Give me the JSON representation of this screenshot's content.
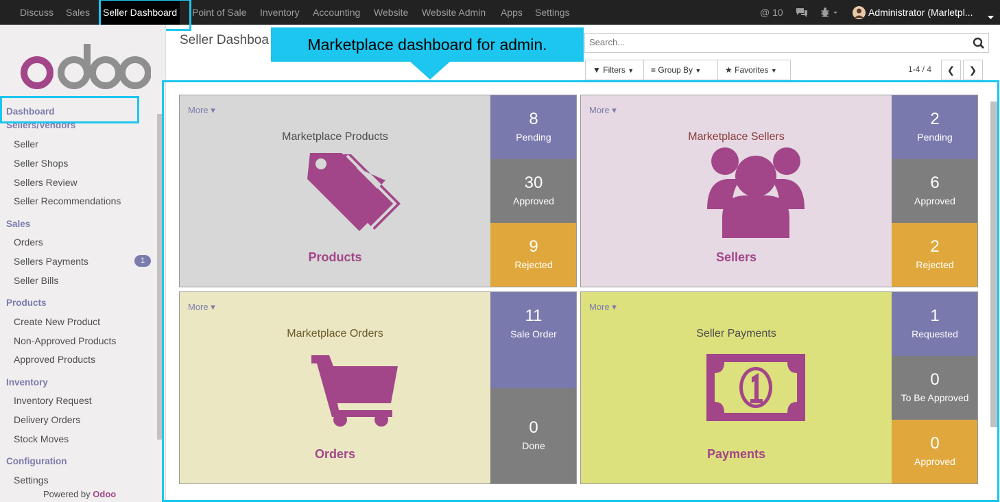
{
  "topnav": {
    "items": [
      "Discuss",
      "Sales",
      "Seller Dashboard",
      "Point of Sale",
      "Inventory",
      "Accounting",
      "Website",
      "Website Admin",
      "Apps",
      "Settings"
    ],
    "mentions": "@ 10",
    "user": "Administrator (Marletpl..."
  },
  "sidebar": {
    "sections": [
      {
        "title": "Dashboard",
        "items": []
      },
      {
        "title": "Sellers/Vendors",
        "items": [
          "Seller",
          "Seller Shops",
          "Sellers Review",
          "Seller Recommendations"
        ]
      },
      {
        "title": "Sales",
        "items": [
          "Orders",
          "Sellers Payments",
          "Seller Bills"
        ]
      },
      {
        "title": "Products",
        "items": [
          "Create New Product",
          "Non-Approved Products",
          "Approved Products"
        ]
      },
      {
        "title": "Inventory",
        "items": [
          "Inventory Request",
          "Delivery Orders",
          "Stock Moves"
        ]
      },
      {
        "title": "Configuration",
        "items": [
          "Settings"
        ]
      }
    ],
    "badge": "1",
    "powered_prefix": "Powered by",
    "powered_brand": "Odoo"
  },
  "control": {
    "breadcrumb": "Seller Dashboa",
    "callout": "Marketplace dashboard for admin.",
    "search_placeholder": "Search...",
    "filters": "Filters",
    "groupby": "Group By",
    "favorites": "Favorites",
    "pager": "1-4 / 4"
  },
  "tiles": [
    {
      "more": "More",
      "title": "Marketplace Products",
      "name": "Products",
      "stats": [
        {
          "n": "8",
          "l": "Pending"
        },
        {
          "n": "30",
          "l": "Approved"
        },
        {
          "n": "9",
          "l": "Rejected"
        }
      ]
    },
    {
      "more": "More",
      "title": "Marketplace Sellers",
      "name": "Sellers",
      "stats": [
        {
          "n": "2",
          "l": "Pending"
        },
        {
          "n": "6",
          "l": "Approved"
        },
        {
          "n": "2",
          "l": "Rejected"
        }
      ]
    },
    {
      "more": "More",
      "title": "Marketplace Orders",
      "name": "Orders",
      "stats": [
        {
          "n": "11",
          "l": "Sale Order"
        },
        {
          "n": "0",
          "l": "Done"
        }
      ]
    },
    {
      "more": "More",
      "title": "Seller Payments",
      "name": "Payments",
      "stats": [
        {
          "n": "1",
          "l": "Requested"
        },
        {
          "n": "0",
          "l": "To Be Approved"
        },
        {
          "n": "0",
          "l": "Approved"
        }
      ]
    }
  ],
  "colors": {
    "accent": "#7c7bad",
    "icon": "#a24689",
    "highlight": "#1cc6ef",
    "stat_purple": "#7a79ad",
    "stat_gray": "#7e7e7e",
    "stat_orange": "#e0a83c",
    "tile_products": "#d7d7d7",
    "tile_sellers": "#e6d9e3",
    "tile_orders": "#ebe7c3",
    "tile_payments": "#dce07d"
  }
}
